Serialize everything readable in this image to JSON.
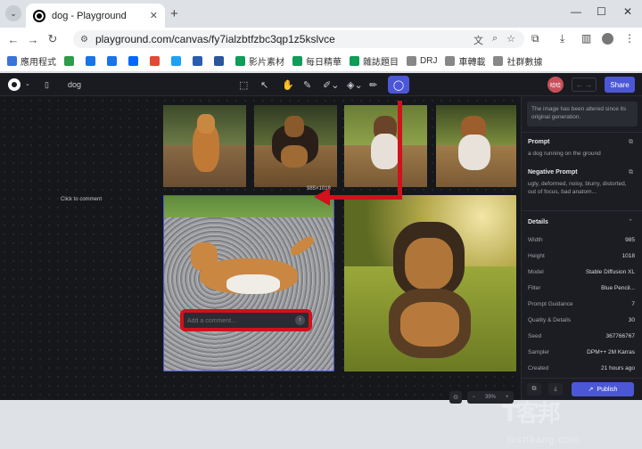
{
  "browser": {
    "tab_title": "dog - Playground",
    "url": "playground.com/canvas/fy7ialzbtfzbc3qp1z5kslvce",
    "bookmarks": [
      {
        "label": "應用程式",
        "color": "#3b73d9"
      },
      {
        "label": "",
        "color": "#2e9c4a"
      },
      {
        "label": "",
        "color": "#1a73e8"
      },
      {
        "label": "",
        "color": "#1a73e8"
      },
      {
        "label": "",
        "color": "#0866ff"
      },
      {
        "label": "",
        "color": "#e34a35"
      },
      {
        "label": "",
        "color": "#1da1f2"
      },
      {
        "label": "",
        "color": "#2a5db0"
      },
      {
        "label": "",
        "color": "#2b579a"
      },
      {
        "label": "影片素材",
        "color": "#0f9d58"
      },
      {
        "label": "每日精華",
        "color": "#0f9d58"
      },
      {
        "label": "雜誌題目",
        "color": "#0f9d58"
      },
      {
        "label": "DRJ",
        "color": "#888"
      },
      {
        "label": "車轉載",
        "color": "#888"
      },
      {
        "label": "社群數據",
        "color": "#888"
      }
    ]
  },
  "app": {
    "project_name": "dog",
    "share_label": "Share",
    "avatar_initials": "哈哈",
    "canvas_hint": "Click to comment",
    "image_dimensions": "985×1018",
    "comment_placeholder": "Add a comment...",
    "zoom_level": "39%",
    "colors": {
      "accent": "#4b57d6",
      "highlight": "#d1111b"
    }
  },
  "panel": {
    "notice": "The image has been altered since its original generation.",
    "prompt_title": "Prompt",
    "prompt_text": "a dog running on the ground",
    "negative_title": "Negative Prompt",
    "negative_text": "ugly, deformed, noisy, blurry, distorted, out of focus, bad anatom...",
    "details_title": "Details",
    "details": [
      {
        "key": "Width",
        "value": "985"
      },
      {
        "key": "Height",
        "value": "1018"
      },
      {
        "key": "Model",
        "value": "Stable Diffusion XL"
      },
      {
        "key": "Filter",
        "value": "Blue Pencil..."
      },
      {
        "key": "Prompt Guidance",
        "value": "7"
      },
      {
        "key": "Quality & Details",
        "value": "30"
      },
      {
        "key": "Seed",
        "value": "367766767"
      },
      {
        "key": "Sampler",
        "value": "DPM++ 2M Karras"
      },
      {
        "key": "Created",
        "value": "21 hours ago"
      }
    ],
    "publish_label": "Publish"
  },
  "watermark": {
    "cn": "T客邦",
    "en": "techbang.com"
  }
}
